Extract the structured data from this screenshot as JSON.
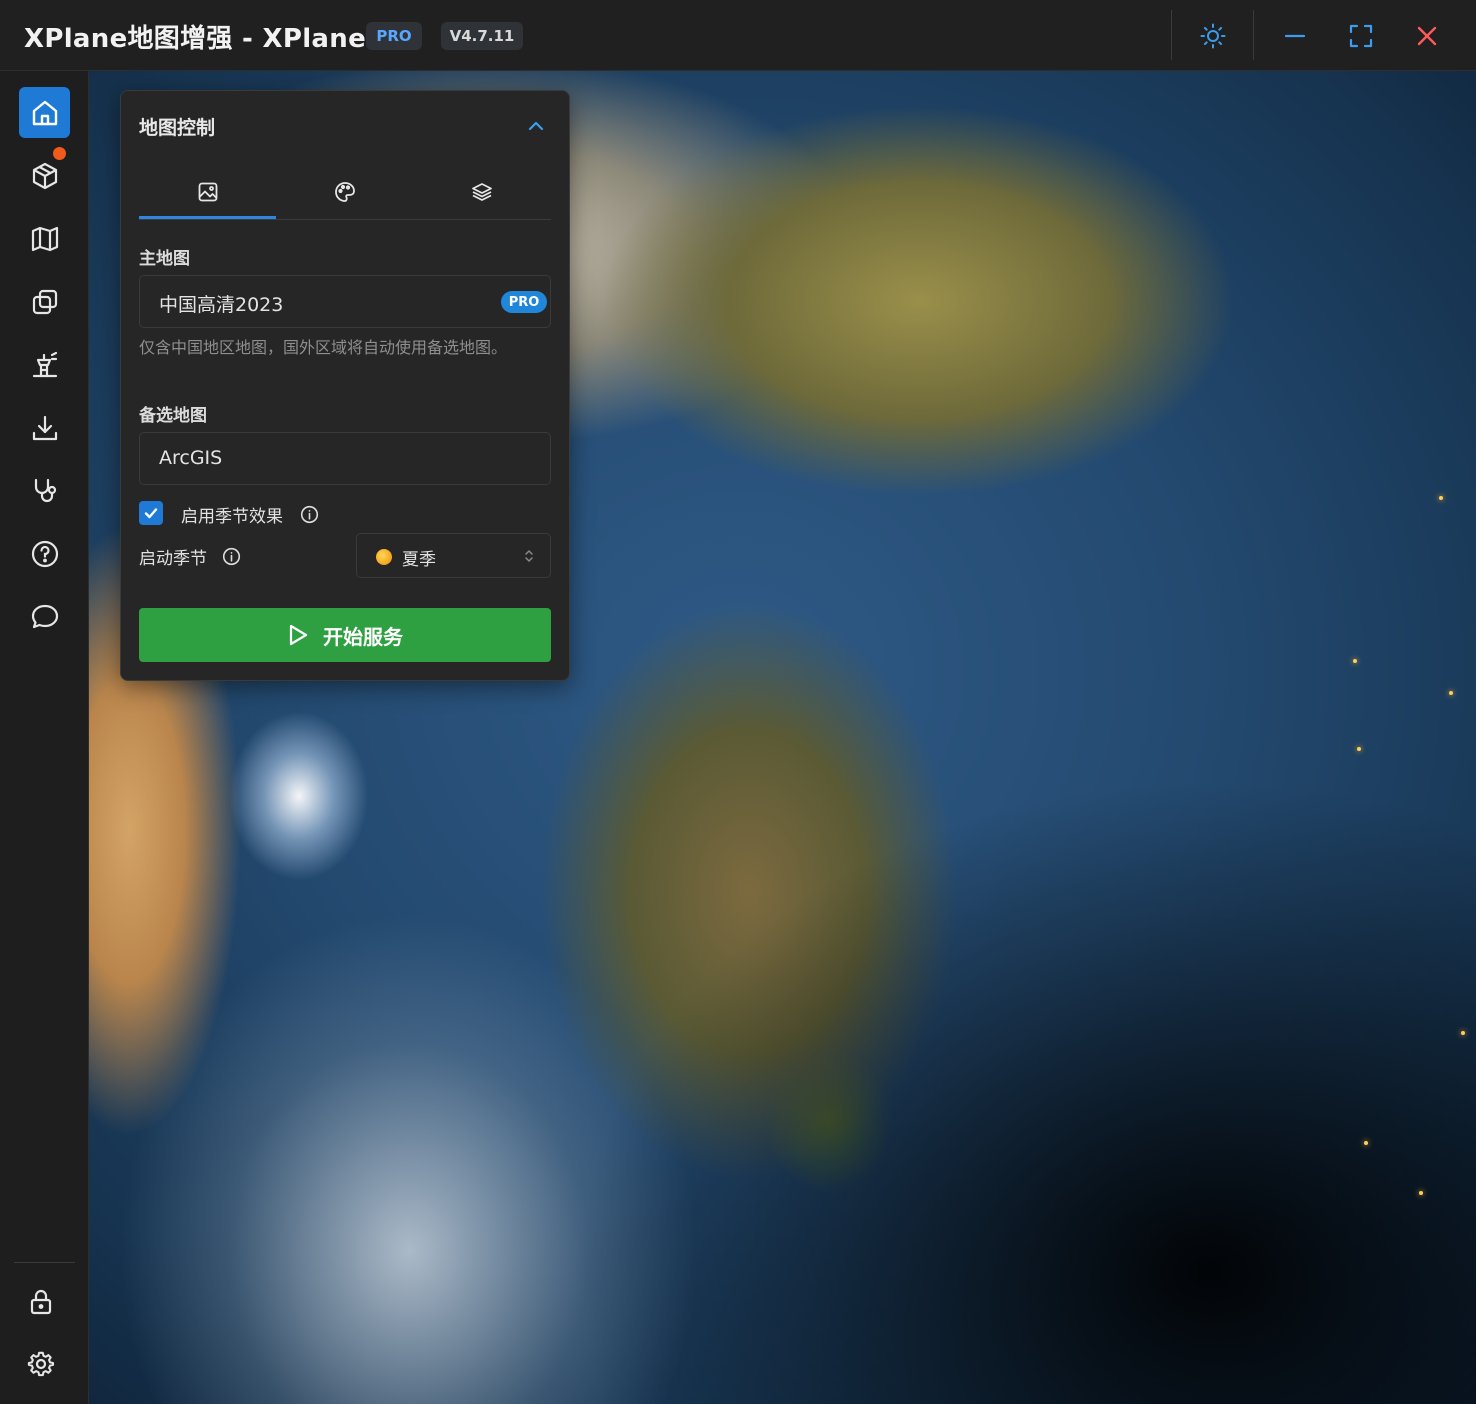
{
  "window": {
    "title": "XPlane地图增强 - XPlane",
    "edition_badge": "PRO",
    "version": "V4.7.11",
    "controls": [
      "theme-toggle",
      "minimize",
      "fullscreen",
      "close"
    ]
  },
  "sidebar": {
    "items": [
      {
        "name": "home",
        "icon": "home-icon",
        "active": true
      },
      {
        "name": "packages",
        "icon": "box-icon",
        "notification": true
      },
      {
        "name": "map",
        "icon": "map-icon"
      },
      {
        "name": "layers",
        "icon": "copy-icon"
      },
      {
        "name": "airport",
        "icon": "tower-icon"
      },
      {
        "name": "download",
        "icon": "download-icon"
      },
      {
        "name": "diagnostics",
        "icon": "stethoscope-icon"
      },
      {
        "name": "help",
        "icon": "help-icon"
      },
      {
        "name": "feedback",
        "icon": "chat-icon"
      }
    ],
    "bottom_items": [
      {
        "name": "lock",
        "icon": "lock-icon"
      },
      {
        "name": "settings",
        "icon": "gear-icon"
      }
    ]
  },
  "panel": {
    "title": "地图控制",
    "tabs": [
      {
        "icon": "image-icon",
        "active": true
      },
      {
        "icon": "palette-icon",
        "active": false
      },
      {
        "icon": "layers-icon",
        "active": false
      }
    ],
    "main_map_label": "主地图",
    "main_map_value": "中国高清2023",
    "main_map_badge": "PRO",
    "main_map_hint": "仅含中国地区地图，国外区域将自动使用备选地图。",
    "backup_map_label": "备选地图",
    "backup_map_value": "ArcGIS",
    "season_effect_label": "启用季节效果",
    "season_effect_checked": true,
    "start_season_label": "启动季节",
    "start_season_value": "夏季",
    "start_button_label": "开始服务"
  },
  "colors": {
    "accent": "#1f7ad6",
    "start_button": "#2fa042",
    "pro_badge": "#1f86d9",
    "notification": "#f05a1a"
  }
}
